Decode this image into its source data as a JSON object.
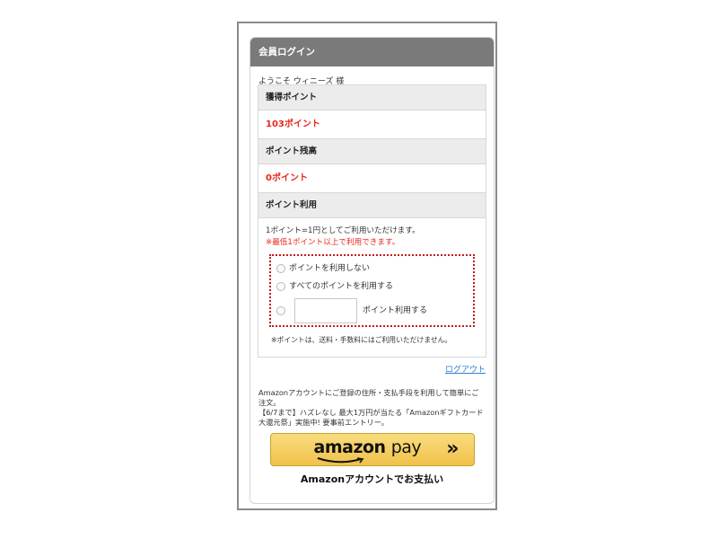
{
  "header": {
    "title": "会員ログイン"
  },
  "welcome": "ようこそ ウィニーズ 様",
  "earned": {
    "label": "獲得ポイント",
    "value": "103ポイント"
  },
  "balance": {
    "label": "ポイント残高",
    "value": "0ポイント"
  },
  "usage": {
    "label": "ポイント利用",
    "description": "1ポイント=1円としてご利用いただけます。",
    "note": "※最低1ポイント以上で利用できます。",
    "options": [
      {
        "label": "ポイントを利用しない"
      },
      {
        "label": "すべてのポイントを利用する"
      }
    ],
    "input_suffix": "ポイント利用する",
    "input_value": "",
    "fee_note": "※ポイントは、送料・手数料にはご利用いただけません。"
  },
  "logout_label": "ログアウト",
  "amazon": {
    "note_line1": "Amazonアカウントにご登録の住所・支払手段を利用して簡単にご注文。",
    "note_line2": "【6/7まで】ハズレなし 最大1万円が当たる「Amazonギフトカード大還元祭」実施中! 要事前エントリー。",
    "logo_amazon": "amazon",
    "logo_pay": "pay",
    "arrow": "»",
    "caption": "Amazonアカウントでお支払い"
  },
  "colors": {
    "accent_red": "#e8261a",
    "link_blue": "#2b7fd1",
    "header_gray": "#7a7a7a",
    "amazon_yellow": "#f0c14b"
  }
}
